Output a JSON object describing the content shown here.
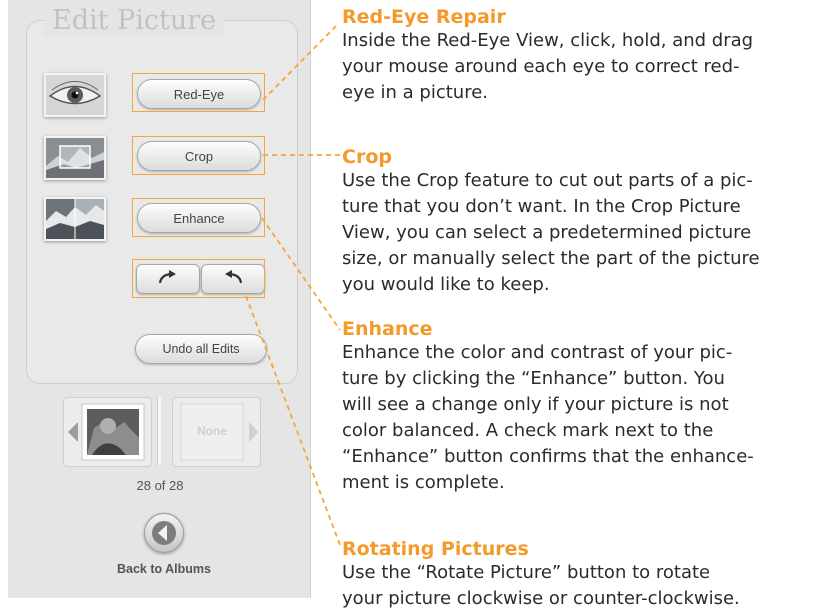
{
  "panel": {
    "title": "Edit Picture",
    "buttons": {
      "red_eye": "Red-Eye",
      "crop": "Crop",
      "enhance": "Enhance",
      "undo_all": "Undo all Edits"
    },
    "rotate_icons": [
      "rotate-clockwise-icon",
      "rotate-counterclockwise-icon"
    ],
    "next_tile_label": "None",
    "counter": "28 of 28",
    "back_label": "Back to Albums"
  },
  "descriptions": [
    {
      "heading": "Red-Eye Repair",
      "body": [
        "Inside the Red-Eye View, click, hold, and drag",
        "your mouse around each eye to correct red-",
        "eye in a picture."
      ]
    },
    {
      "heading": "Crop",
      "body": [
        "Use the Crop feature to cut out parts of a pic-",
        "ture that you don’t want. In the Crop Picture",
        "View, you can select a predetermined picture",
        "size, or manually select the part of the picture",
        "you would like to keep."
      ]
    },
    {
      "heading": "Enhance",
      "body": [
        "Enhance the color and contrast of your pic-",
        "ture by clicking the “Enhance” button. You",
        "will see a change only if your picture is not",
        "color balanced. A check mark next to the",
        "“Enhance” button confirms that the enhance-",
        "ment is complete."
      ]
    },
    {
      "heading": "Rotating Pictures",
      "body": [
        "Use the “Rotate Picture” button to rotate",
        "your picture clockwise or counter-clockwise."
      ]
    }
  ],
  "colors": {
    "accent": "#f39a2a",
    "panel_bg": "#e5e5e5",
    "body_text": "#2b2b2b"
  }
}
